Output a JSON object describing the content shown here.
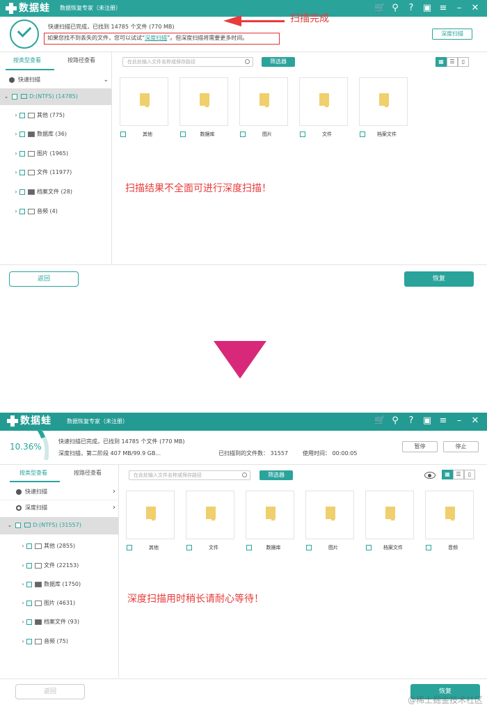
{
  "colors": {
    "accent": "#2aa39b",
    "annotation": "#e83b3b",
    "arrow_down": "#d8287a"
  },
  "panel1": {
    "logo_text": "数据蛙",
    "app_title": "数据恢复专家（未注册）",
    "window_icons": [
      "cart-icon",
      "key-icon",
      "help-icon",
      "save-icon",
      "menu-icon",
      "minimize-icon",
      "close-icon"
    ],
    "status_line": "快速扫描已完成，已找到 14785 个文件 (770 MB)",
    "hint_prefix": "如果您找不到丢失的文件，您可以试试“",
    "hint_link": "深度扫描",
    "hint_suffix": "”。但深度扫描将需要更多时间。",
    "annotation_done": "扫描完成",
    "deep_scan_button": "深度扫描",
    "tabs": [
      "按类型查看",
      "按路径查看"
    ],
    "scan_label": "快速扫描",
    "drive_label": "D:(NTFS) (14785)",
    "categories": [
      {
        "name": "其他 (775)"
      },
      {
        "name": "数据库 (36)"
      },
      {
        "name": "图片 (1965)"
      },
      {
        "name": "文件 (11977)"
      },
      {
        "name": "档案文件 (28)"
      },
      {
        "name": "音频 (4)"
      }
    ],
    "search_placeholder": "在此处输入文件名称或保存路径",
    "filter_button": "筛选器",
    "tiles": [
      "其他",
      "数据库",
      "图片",
      "文件",
      "档案文件"
    ],
    "annotation_main": "扫描结果不全面可进行深度扫描！",
    "back_button": "返回",
    "recover_button": "恢复"
  },
  "panel2": {
    "logo_text": "数据蛙",
    "app_title": "数据恢复专家（未注册）",
    "progress_text": "10.36%",
    "progress_fraction": 0.1036,
    "status_line1": "快速扫描已完成，已找到 14785 个文件 (770 MB)",
    "status_line2": "深度扫描，第二阶段 407 MB/99.9 GB...",
    "scanned_label": "已扫描到的文件数：",
    "scanned_count": "31557",
    "time_label": "使用时间：",
    "time_value": "00:00:05",
    "pause_button": "暂停",
    "stop_button": "停止",
    "tabs": [
      "按类型查看",
      "按路径查看"
    ],
    "quick_scan_label": "快速扫描",
    "deep_scan_label": "深度扫描",
    "drive_label": "D:(NTFS) (31557)",
    "categories": [
      {
        "name": "其他 (2855)"
      },
      {
        "name": "文件 (22153)"
      },
      {
        "name": "数据库 (1750)"
      },
      {
        "name": "图片 (4631)"
      },
      {
        "name": "档案文件 (93)"
      },
      {
        "name": "音频 (75)"
      }
    ],
    "search_placeholder": "在此处输入文件名称或保存路径",
    "filter_button": "筛选器",
    "tiles": [
      "其他",
      "文件",
      "数据库",
      "图片",
      "档案文件",
      "音频"
    ],
    "annotation_main": "深度扫描用时稍长请耐心等待！",
    "back_button": "返回",
    "recover_button": "恢复",
    "watermark": "@稀土掘金技术社区"
  }
}
